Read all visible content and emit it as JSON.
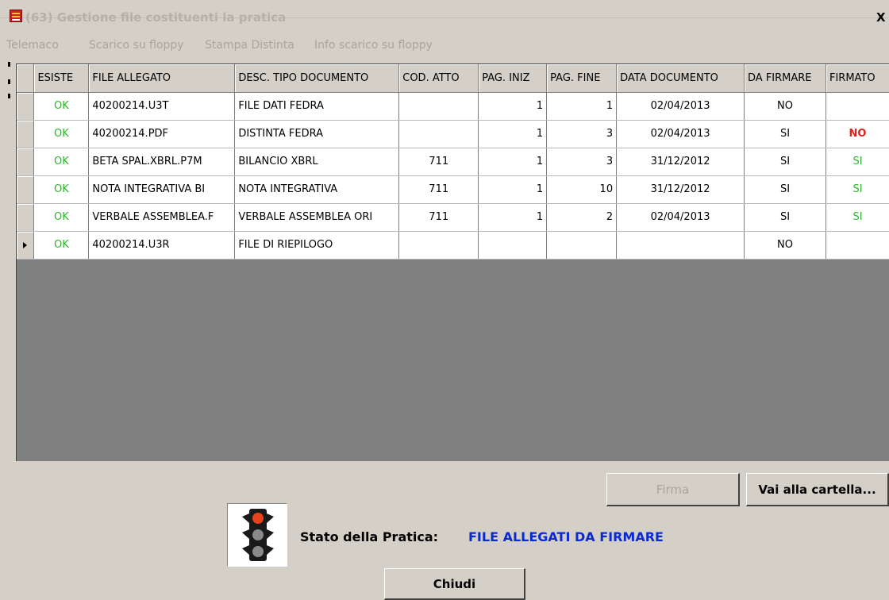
{
  "window": {
    "title": "(63) Gestione file costituenti la pratica",
    "close_label": "X"
  },
  "menu": [
    "Telemaco",
    "Scarico su floppy",
    "Stampa Distinta",
    "Info scarico su floppy"
  ],
  "table": {
    "columns": [
      "ESISTE",
      "FILE ALLEGATO",
      "DESC. TIPO DOCUMENTO",
      "COD. ATTO",
      "PAG. INIZ",
      "PAG. FINE",
      "DATA DOCUMENTO",
      "DA FIRMARE",
      "FIRMATO"
    ],
    "rows": [
      {
        "esiste": "OK",
        "file": "40200214.U3T",
        "desc": "FILE DATI FEDRA",
        "cod": "",
        "pag_iniz": "1",
        "pag_fine": "1",
        "data": "02/04/2013",
        "da_firmare": "NO",
        "firmato": ""
      },
      {
        "esiste": "OK",
        "file": "40200214.PDF",
        "desc": "DISTINTA FEDRA",
        "cod": "",
        "pag_iniz": "1",
        "pag_fine": "3",
        "data": "02/04/2013",
        "da_firmare": "SI",
        "firmato": "NO"
      },
      {
        "esiste": "OK",
        "file": "BETA SPAL.XBRL.P7M",
        "desc": "BILANCIO XBRL",
        "cod": "711",
        "pag_iniz": "1",
        "pag_fine": "3",
        "data": "31/12/2012",
        "da_firmare": "SI",
        "firmato": "SI"
      },
      {
        "esiste": "OK",
        "file": "NOTA INTEGRATIVA BI",
        "desc": "NOTA INTEGRATIVA",
        "cod": "711",
        "pag_iniz": "1",
        "pag_fine": "10",
        "data": "31/12/2012",
        "da_firmare": "SI",
        "firmato": "SI"
      },
      {
        "esiste": "OK",
        "file": "VERBALE ASSEMBLEA.F",
        "desc": "VERBALE ASSEMBLEA ORI",
        "cod": "711",
        "pag_iniz": "1",
        "pag_fine": "2",
        "data": "02/04/2013",
        "da_firmare": "SI",
        "firmato": "SI"
      },
      {
        "esiste": "OK",
        "file": "40200214.U3R",
        "desc": "FILE DI RIEPILOGO",
        "cod": "",
        "pag_iniz": "",
        "pag_fine": "",
        "data": "",
        "da_firmare": "NO",
        "firmato": ""
      }
    ],
    "active_row": 5
  },
  "buttons": {
    "firma": "Firma",
    "vai": "Vai alla cartella...",
    "chiudi": "Chiudi"
  },
  "status": {
    "label": "Stato della Pratica:",
    "value": "FILE ALLEGATI DA FIRMARE",
    "icon": "traffic-light-icon"
  },
  "colors": {
    "ok_green": "#2db42d",
    "alert_red": "#e0201c",
    "status_blue": "#0b2bd0"
  }
}
